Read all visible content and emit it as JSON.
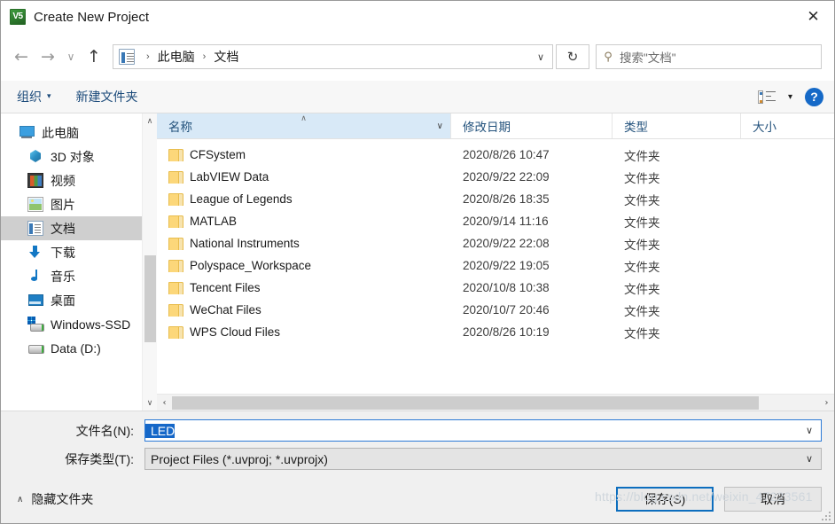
{
  "window": {
    "title": "Create New Project",
    "icon": "keil-uvision-icon",
    "close_label": "✕"
  },
  "nav": {
    "back": "←",
    "forward": "→",
    "recent": "∨",
    "up": "↑",
    "refresh": "↻",
    "breadcrumb": [
      "此电脑",
      "文档"
    ],
    "breadcrumb_sep": "›",
    "address_chevron": "∨"
  },
  "search": {
    "icon": "search-icon",
    "placeholder": "搜索\"文档\""
  },
  "commandbar": {
    "organize_label": "组织",
    "organize_caret": "▾",
    "new_folder_label": "新建文件夹",
    "view_caret": "▾",
    "help_label": "?"
  },
  "sidebar": {
    "items": [
      {
        "label": "此电脑",
        "icon": "computer-icon",
        "level": 0,
        "selected": false
      },
      {
        "label": "3D 对象",
        "icon": "3d-objects-icon",
        "level": 1,
        "selected": false
      },
      {
        "label": "视频",
        "icon": "videos-icon",
        "level": 1,
        "selected": false
      },
      {
        "label": "图片",
        "icon": "pictures-icon",
        "level": 1,
        "selected": false
      },
      {
        "label": "文档",
        "icon": "documents-icon",
        "level": 1,
        "selected": true
      },
      {
        "label": "下载",
        "icon": "downloads-icon",
        "level": 1,
        "selected": false
      },
      {
        "label": "音乐",
        "icon": "music-icon",
        "level": 1,
        "selected": false
      },
      {
        "label": "桌面",
        "icon": "desktop-icon",
        "level": 1,
        "selected": false
      },
      {
        "label": "Windows-SSD",
        "icon": "ssd-drive-icon",
        "level": 1,
        "selected": false
      },
      {
        "label": "Data (D:)",
        "icon": "drive-icon",
        "level": 1,
        "selected": false
      }
    ],
    "scroll_up": "∧",
    "scroll_down": "∨"
  },
  "filelist": {
    "columns": [
      {
        "label": "名称",
        "sorted": true,
        "sort_mark": "∧",
        "chevron": "∨"
      },
      {
        "label": "修改日期",
        "sorted": false
      },
      {
        "label": "类型",
        "sorted": false
      },
      {
        "label": "大小",
        "sorted": false
      }
    ],
    "rows": [
      {
        "name": "CFSystem",
        "date": "2020/8/26 10:47",
        "type": "文件夹",
        "size": ""
      },
      {
        "name": "LabVIEW Data",
        "date": "2020/9/22 22:09",
        "type": "文件夹",
        "size": ""
      },
      {
        "name": "League of Legends",
        "date": "2020/8/26 18:35",
        "type": "文件夹",
        "size": ""
      },
      {
        "name": "MATLAB",
        "date": "2020/9/14 11:16",
        "type": "文件夹",
        "size": ""
      },
      {
        "name": "National Instruments",
        "date": "2020/9/22 22:08",
        "type": "文件夹",
        "size": ""
      },
      {
        "name": "Polyspace_Workspace",
        "date": "2020/9/22 19:05",
        "type": "文件夹",
        "size": ""
      },
      {
        "name": "Tencent Files",
        "date": "2020/10/8 10:38",
        "type": "文件夹",
        "size": ""
      },
      {
        "name": "WeChat Files",
        "date": "2020/10/7 20:46",
        "type": "文件夹",
        "size": ""
      },
      {
        "name": "WPS Cloud Files",
        "date": "2020/8/26 10:19",
        "type": "文件夹",
        "size": ""
      }
    ],
    "hscroll_left": "‹",
    "hscroll_right": "›"
  },
  "form": {
    "filename_label": "文件名(N):",
    "filename_value": "LED",
    "filename_chevron": "∨",
    "savetype_label": "保存类型(T):",
    "savetype_value": "Project Files (*.uvproj; *.uvprojx)",
    "savetype_chevron": "∨"
  },
  "footer": {
    "hide_folders_chevron": "∧",
    "hide_folders_label": "隐藏文件夹",
    "save_label": "保存(S)",
    "cancel_label": "取消"
  },
  "watermark": "https://blog.csdn.net/weixin_47223561",
  "colors": {
    "accent": "#0d6ebe",
    "selection": "#1567c8",
    "sorted_column": "#d8e9f7",
    "folder": "#fcd77a",
    "link": "#1b4a7a"
  }
}
